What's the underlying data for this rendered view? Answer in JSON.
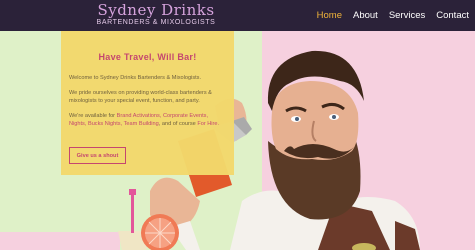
{
  "brand": {
    "name": "Sydney Drinks",
    "tagline": "BARTENDERS & MIXOLOGISTS"
  },
  "nav": {
    "items": [
      {
        "label": "Home",
        "active": true
      },
      {
        "label": "About",
        "active": false
      },
      {
        "label": "Services",
        "active": false
      },
      {
        "label": "Contact",
        "active": false
      }
    ]
  },
  "hero": {
    "heading": "Have Travel, Will Bar!",
    "paragraph1": "Welcome to Sydney Drinks Bartenders & Mixologists.",
    "paragraph2": "We pride ourselves on providing world-class bartenders & mixologists to your special event, function, and party.",
    "paragraph3_start": "We're available for ",
    "paragraph3_highlight": "Brand Activations, Corporate Events, Nights, Bucks Nights, Team Building",
    "paragraph3_mid": ", and of course ",
    "paragraph3_end": "For Hire.",
    "cta_label": "Give us a shout"
  },
  "colors": {
    "header_bg": "#2b2239",
    "accent_pink": "#c4416c",
    "card_yellow": "#f3d96c",
    "nav_active": "#f1b43a",
    "bg_green": "#dff1c8",
    "bg_pink": "#f6d0df"
  }
}
